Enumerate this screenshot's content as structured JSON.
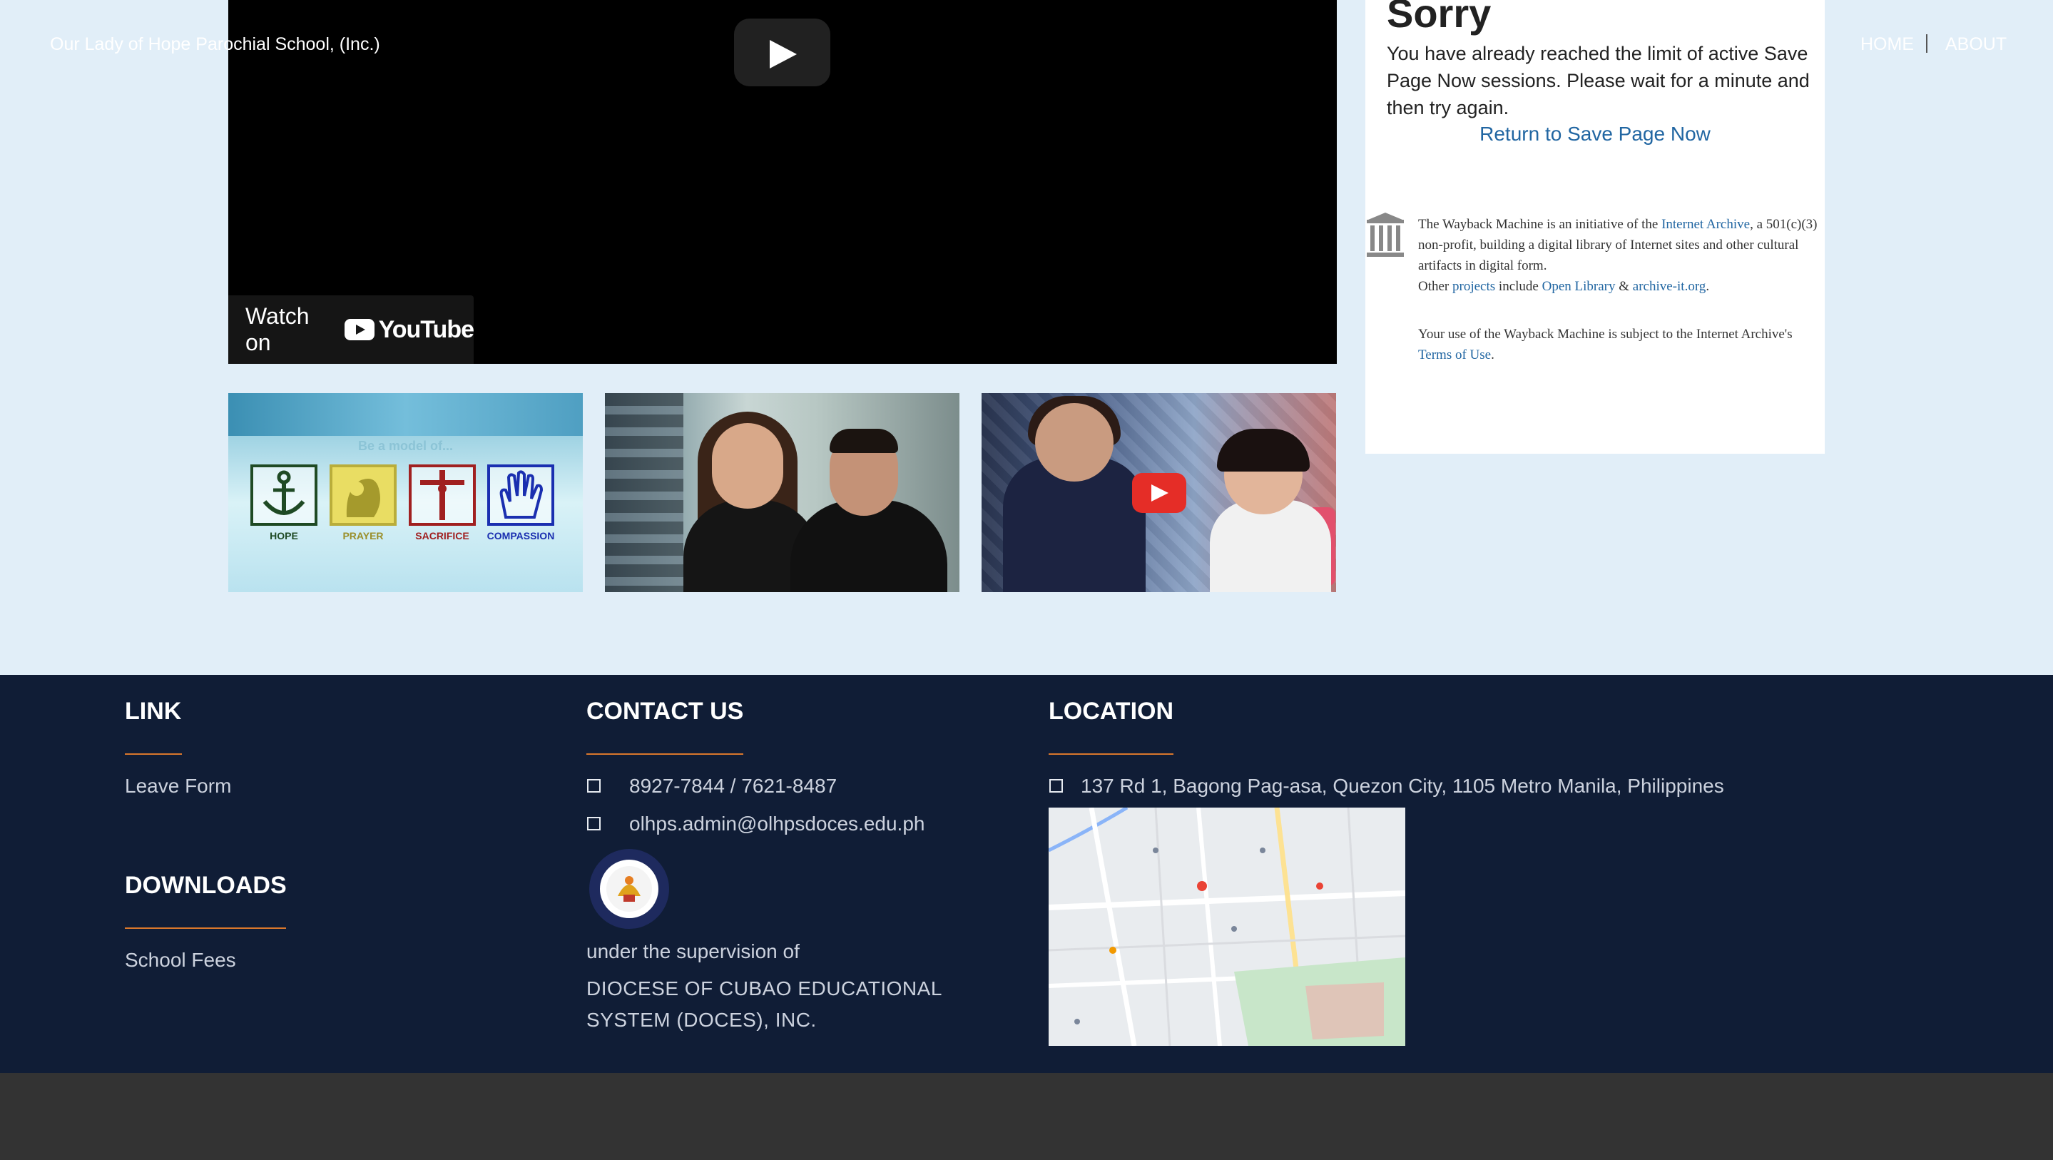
{
  "video": {
    "watch_on_label": "Watch on",
    "youtube_wordmark": "YouTube",
    "play_icon": "play-icon"
  },
  "thumbnails": [
    {
      "caption": "Be a model of...",
      "virtues": [
        "HOPE",
        "PRAYER",
        "SACRIFICE",
        "COMPASSION"
      ]
    },
    {
      "caption": ""
    },
    {
      "caption": ""
    }
  ],
  "wayback": {
    "title": "Sorry",
    "message": "You have already reached the limit of active Save Page Now sessions. Please wait for a minute and then try again.",
    "return_link": "Return to Save Page Now",
    "about_pre": "The Wayback Machine is an initiative of the ",
    "about_ia": "Internet Archive",
    "about_post": ", a 501(c)(3) non-profit, building a digital library of Internet sites and other cultural artifacts in digital form.",
    "other_pre": "Other ",
    "other_projects": "projects",
    "other_mid": " include ",
    "other_ol": "Open Library",
    "other_amp": " & ",
    "other_ait": "archive-it.org",
    "other_end": ".",
    "terms_pre": "Your use of the Wayback Machine is subject to the Internet Archive's ",
    "terms_link": "Terms of Use",
    "terms_end": "."
  },
  "footer": {
    "link": {
      "title": "LINK",
      "items": [
        "Leave Form"
      ]
    },
    "downloads": {
      "title": "DOWNLOADS",
      "items": [
        "School Fees"
      ]
    },
    "contact": {
      "title": "CONTACT US",
      "phone": "8927-7844 / 7621-8487",
      "email": "olhps.admin@olhpsdoces.edu.ph",
      "supervision": "under the supervision of",
      "org_line1": "DIOCESE OF CUBAO EDUCATIONAL",
      "org_line2": "SYSTEM (DOCES), INC."
    },
    "location": {
      "title": "LOCATION",
      "address": "137 Rd 1, Bagong Pag-asa, Quezon City, 1105 Metro Manila, Philippines"
    }
  },
  "bottom_bar": {
    "copyright": "Our Lady of Hope Parochial School, (Inc.)",
    "nav": [
      "HOME",
      "ABOUT"
    ]
  },
  "colors": {
    "page_bg": "#e1eef8",
    "footer_bg": "#101d36",
    "accent_rule": "#d9772c",
    "link_blue": "#2166a2",
    "bottom_bar_bg": "#333333"
  }
}
